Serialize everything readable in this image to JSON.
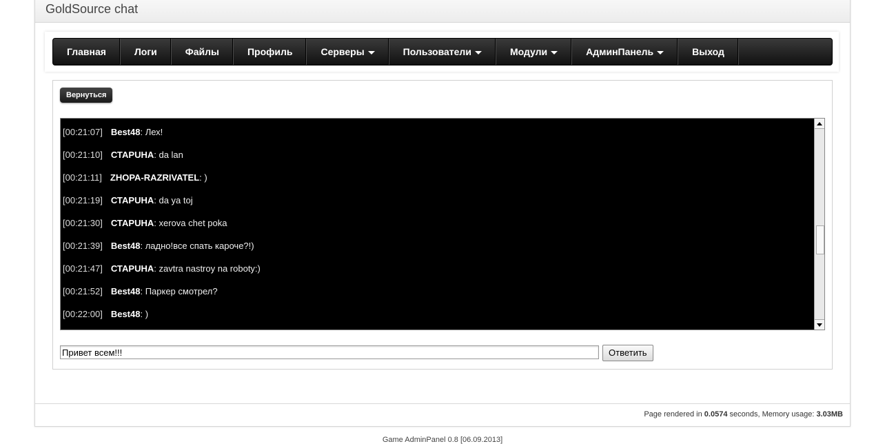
{
  "header": {
    "title": "GoldSource chat"
  },
  "nav": {
    "items": [
      {
        "label": "Главная",
        "dropdown": false
      },
      {
        "label": "Логи",
        "dropdown": false
      },
      {
        "label": "Файлы",
        "dropdown": false
      },
      {
        "label": "Профиль",
        "dropdown": false
      },
      {
        "label": "Серверы",
        "dropdown": true
      },
      {
        "label": "Пользователи",
        "dropdown": true
      },
      {
        "label": "Модули",
        "dropdown": true
      },
      {
        "label": "АдминПанель",
        "dropdown": true
      },
      {
        "label": "Выход",
        "dropdown": false
      }
    ]
  },
  "content": {
    "back_label": "Вернуться",
    "messages": [
      {
        "time": "[00:21:07]",
        "user": "Best48",
        "text": ": Лех!"
      },
      {
        "time": "[00:21:10]",
        "user": "СТАРUНА",
        "text": ": da lan"
      },
      {
        "time": "[00:21:11]",
        "user": "ZHOPA-RAZRIVATEL",
        "text": ": )"
      },
      {
        "time": "[00:21:19]",
        "user": "СТАРUНА",
        "text": ": da ya toj"
      },
      {
        "time": "[00:21:30]",
        "user": "СТАРUНА",
        "text": ": xerova chet poka"
      },
      {
        "time": "[00:21:39]",
        "user": "Best48",
        "text": ": ладно!все спать кароче?!)"
      },
      {
        "time": "[00:21:47]",
        "user": "СТАРUНА",
        "text": ": zavtra nastroy na roboty:)"
      },
      {
        "time": "[00:21:52]",
        "user": "Best48",
        "text": ": Паркер смотрел?"
      },
      {
        "time": "[00:22:00]",
        "user": "Best48",
        "text": ": )"
      }
    ],
    "input_value": "Привет всем!!!",
    "reply_label": "Ответить"
  },
  "footer": {
    "render_prefix": "Page rendered in ",
    "render_time": "0.0574",
    "render_mid": " seconds, Memory usage: ",
    "memory": "3.03MB",
    "credit": "Game AdminPanel 0.8 [06.09.2013]"
  },
  "colors": {
    "nav_bg": "#1a1a1a",
    "chat_bg": "#000000",
    "chat_text": "#ffffff"
  }
}
